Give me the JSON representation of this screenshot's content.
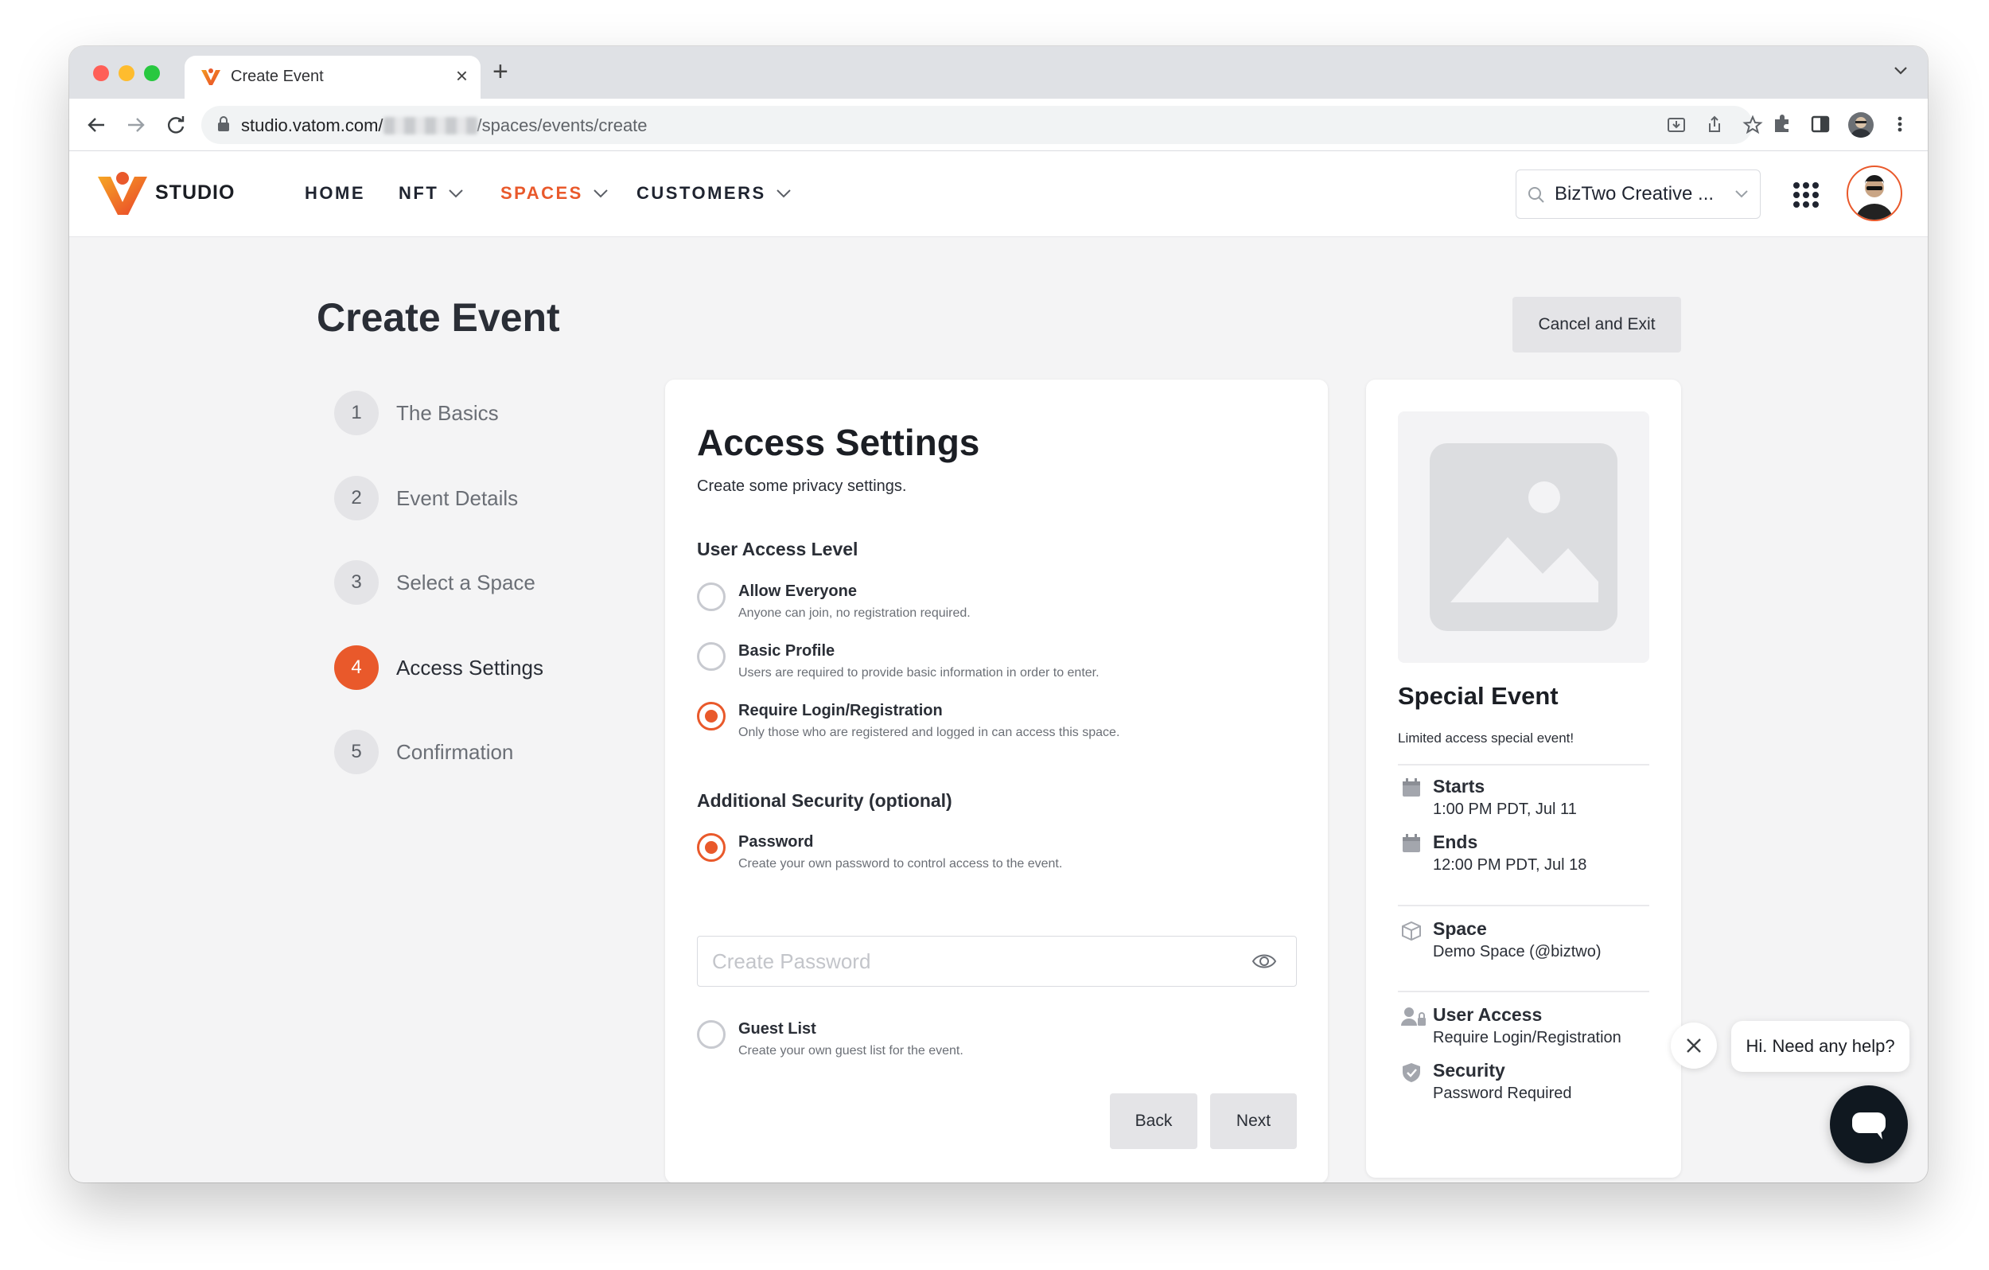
{
  "browser": {
    "tab_title": "Create Event",
    "url_host": "studio.vatom.com/",
    "url_path": "/spaces/events/create"
  },
  "header": {
    "brand": "STUDIO",
    "nav": [
      {
        "label": "HOME"
      },
      {
        "label": "NFT"
      },
      {
        "label": "SPACES"
      },
      {
        "label": "CUSTOMERS"
      }
    ],
    "org_selector_value": "BizTwo Creative ...",
    "accent_color": "#e9592b"
  },
  "page": {
    "title": "Create Event",
    "cancel_label": "Cancel and Exit"
  },
  "steps": [
    {
      "num": "1",
      "label": "The Basics"
    },
    {
      "num": "2",
      "label": "Event Details"
    },
    {
      "num": "3",
      "label": "Select a Space"
    },
    {
      "num": "4",
      "label": "Access Settings"
    },
    {
      "num": "5",
      "label": "Confirmation"
    }
  ],
  "form": {
    "title": "Access Settings",
    "subtitle": "Create some privacy settings.",
    "access_section": "User Access Level",
    "access_options": [
      {
        "label": "Allow Everyone",
        "desc": "Anyone can join, no registration required.",
        "checked": false
      },
      {
        "label": "Basic Profile",
        "desc": "Users are required to provide basic information in order to enter.",
        "checked": false
      },
      {
        "label": "Require Login/Registration",
        "desc": "Only those who are registered and logged in can access this space.",
        "checked": true
      }
    ],
    "security_section": "Additional Security (optional)",
    "security_options": [
      {
        "label": "Password",
        "desc": "Create your own password to control access to the event.",
        "checked": true
      },
      {
        "label": "Guest List",
        "desc": "Create your own guest list for the event.",
        "checked": false
      }
    ],
    "password_placeholder": "Create Password",
    "back_label": "Back",
    "next_label": "Next"
  },
  "summary": {
    "title": "Special Event",
    "description": "Limited access special event!",
    "starts_label": "Starts",
    "starts_value": "1:00 PM PDT, Jul 11",
    "ends_label": "Ends",
    "ends_value": "12:00 PM PDT, Jul 18",
    "space_label": "Space",
    "space_value": "Demo Space (@biztwo)",
    "access_label": "User Access",
    "access_value": "Require Login/Registration",
    "security_label": "Security",
    "security_value": "Password Required"
  },
  "help": {
    "bubble_text": "Hi. Need any help?"
  }
}
